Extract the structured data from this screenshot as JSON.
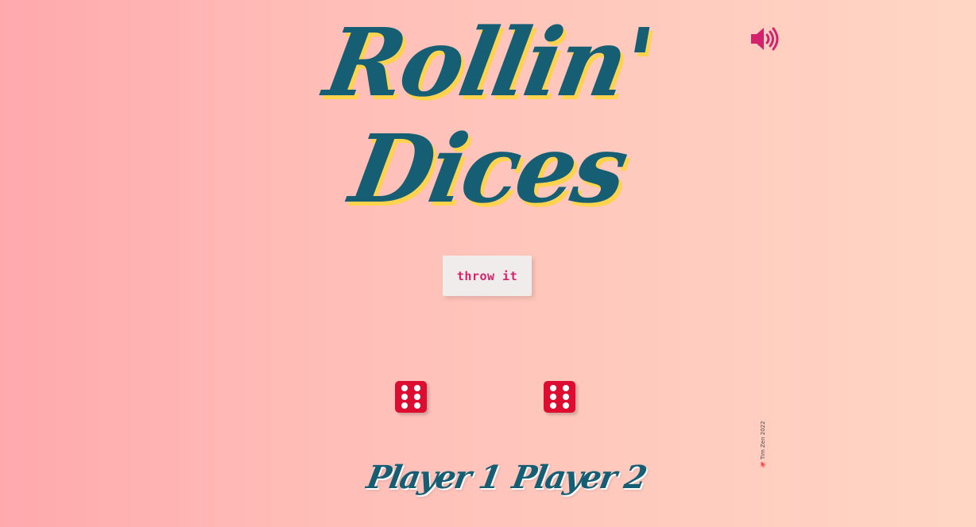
{
  "game": {
    "title_line1": "Rollin'",
    "title_line2": "Dices",
    "sound_icon": "volume-high-icon",
    "throw_label": "throw it",
    "dice": [
      {
        "value": 6,
        "color": "#dc0d31"
      },
      {
        "value": 6,
        "color": "#dc0d31"
      }
    ],
    "players": [
      "Player 1",
      "Player 2"
    ],
    "credit": "🐙 Tim Zen 2022"
  },
  "colors": {
    "title": "#155e73",
    "title_shadow": "#ffd34e",
    "accent": "#d4236d",
    "die": "#dc0d31"
  }
}
